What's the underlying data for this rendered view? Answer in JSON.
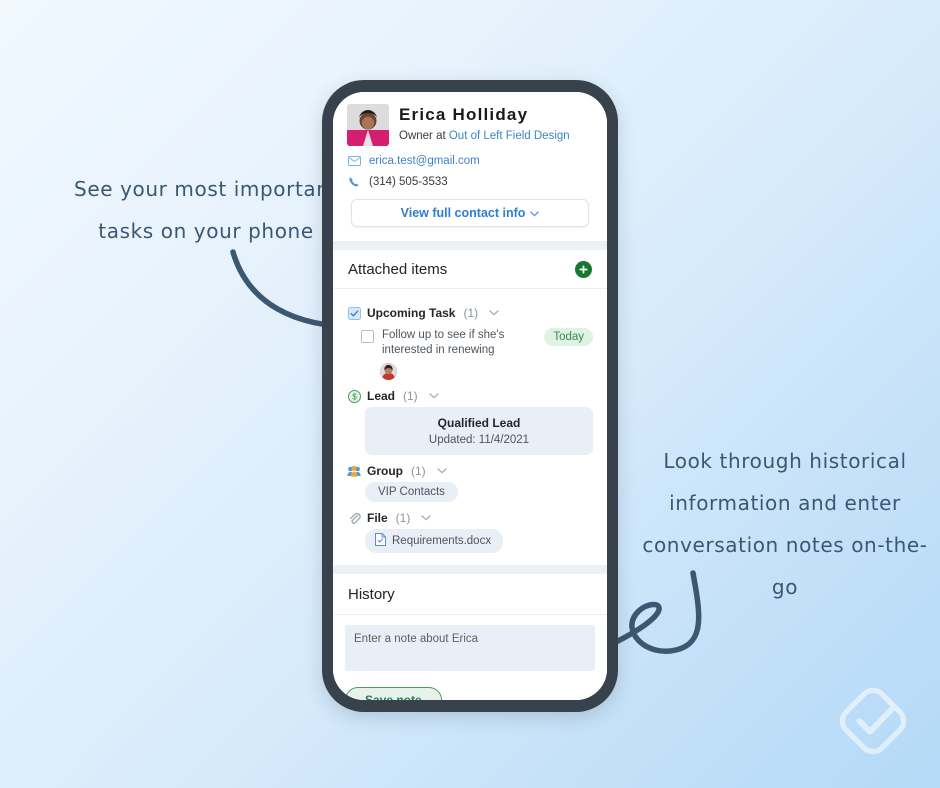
{
  "annotations": {
    "left_note": "See your most important\ntasks on your phone",
    "right_note": "Look through historical\ninformation and enter\nconversation notes on-the-go"
  },
  "colors": {
    "background_start": "#f0f8fe",
    "background_end": "#b4daf7",
    "phone_bezel": "#37424c",
    "link_blue": "#3d83c8",
    "accent_green": "#16792f",
    "badge_green_bg": "#dff2e3",
    "badge_green_text": "#3a8a4e",
    "pill_bg": "#e9eef7",
    "annotation_ink": "#3c5771"
  },
  "contact": {
    "name": "Erica Holliday",
    "role_prefix": "Owner at ",
    "company": "Out of Left Field Design",
    "email": "erica.test@gmail.com",
    "phone": "(314) 505-3533",
    "view_full_label": "View full contact info",
    "email_icon": "envelope-icon",
    "phone_icon": "phone-icon",
    "chevron_icon": "chevron-down-icon",
    "avatar_icon": "contact-avatar"
  },
  "attached": {
    "title": "Attached items",
    "add_icon": "plus-icon",
    "groups": [
      {
        "label": "Upcoming Task",
        "count": "(1)",
        "icon": "task-checkbox-icon",
        "chevron": "chevron-down-icon"
      },
      {
        "label": "Lead",
        "count": "(1)",
        "icon": "lead-dollar-icon",
        "chevron": "chevron-down-icon"
      },
      {
        "label": "Group",
        "count": "(1)",
        "icon": "people-group-icon",
        "chevron": "chevron-down-icon"
      },
      {
        "label": "File",
        "count": "(1)",
        "icon": "paperclip-icon",
        "chevron": "chevron-down-icon"
      }
    ],
    "task": {
      "text": "Follow up to see if she's interested in renewing",
      "badge": "Today",
      "checkbox_icon": "checkbox-unchecked-icon",
      "assignee_icon": "assignee-avatar"
    },
    "lead": {
      "title": "Qualified Lead",
      "updated": "Updated: 11/4/2021"
    },
    "group_item": "VIP Contacts",
    "file_item": {
      "name": "Requirements.docx",
      "icon": "document-icon"
    }
  },
  "history": {
    "title": "History",
    "note_placeholder": "Enter a note about Erica",
    "note_value": "",
    "save_label": "Save note"
  },
  "watermark": {
    "icon": "nimble-check-logo"
  }
}
